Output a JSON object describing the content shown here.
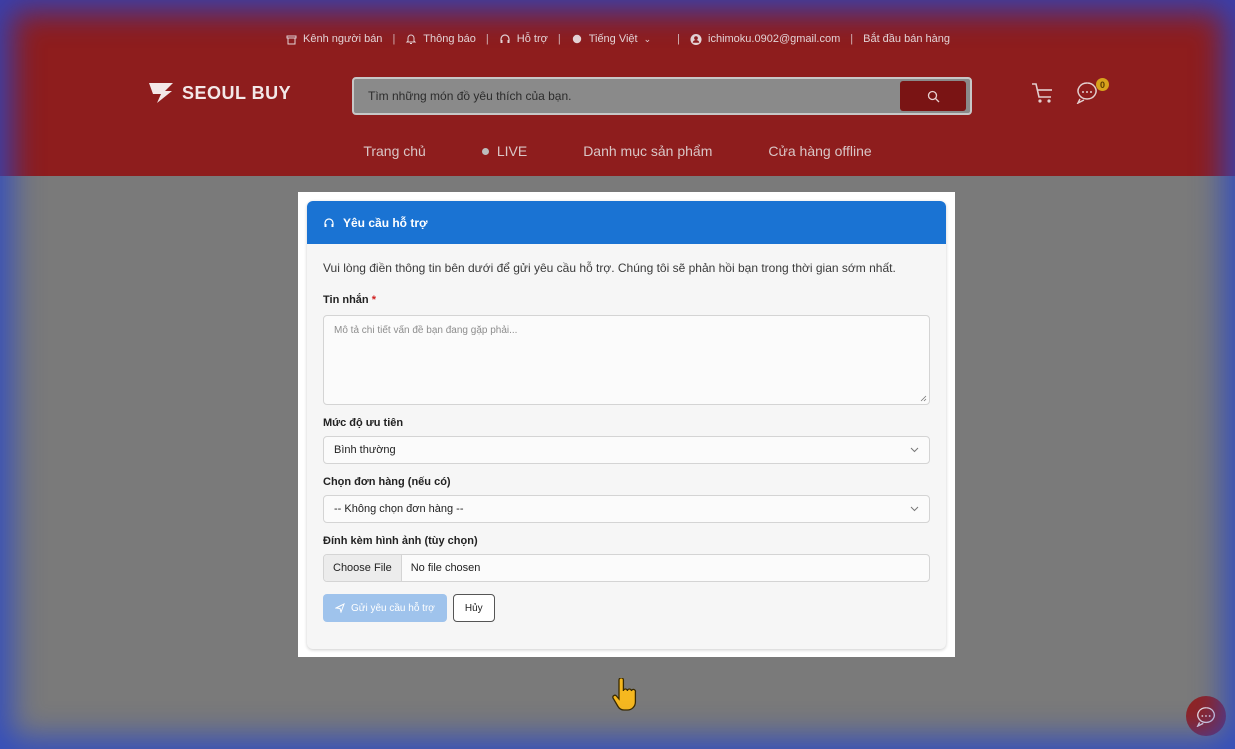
{
  "topbar": {
    "seller_channel": "Kênh người bán",
    "notifications": "Thông báo",
    "support": "Hỗ trợ",
    "language": "Tiếng Việt",
    "email": "ichimoku.0902@gmail.com",
    "start_selling": "Bắt đầu bán hàng"
  },
  "brand": {
    "name": "SEOUL BUY"
  },
  "search": {
    "placeholder": "Tìm những món đồ yêu thích của bạn."
  },
  "cart": {
    "badge": "0"
  },
  "nav": {
    "home": "Trang chủ",
    "live": "LIVE",
    "categories": "Danh mục sản phẩm",
    "offline_store": "Cửa hàng offline"
  },
  "support_form": {
    "title": "Yêu cầu hỗ trợ",
    "intro": "Vui lòng điền thông tin bên dưới để gửi yêu cầu hỗ trợ. Chúng tôi sẽ phản hồi bạn trong thời gian sớm nhất.",
    "message_label": "Tin nhắn",
    "required_mark": "*",
    "message_placeholder": "Mô tả chi tiết vấn đề bạn đang gặp phải...",
    "priority_label": "Mức độ ưu tiên",
    "priority_value": "Bình thường",
    "order_label": "Chọn đơn hàng (nếu có)",
    "order_value": "-- Không chọn đơn hàng --",
    "attach_label": "Đính kèm hình ảnh (tùy chọn)",
    "choose_file": "Choose File",
    "no_file": "No file chosen",
    "submit": "Gửi yêu cầu hỗ trợ",
    "cancel": "Hủy"
  },
  "colors": {
    "header_bg": "#8e1d1d",
    "card_header": "#1a73d3",
    "submit_bg": "#9fc3ec"
  }
}
